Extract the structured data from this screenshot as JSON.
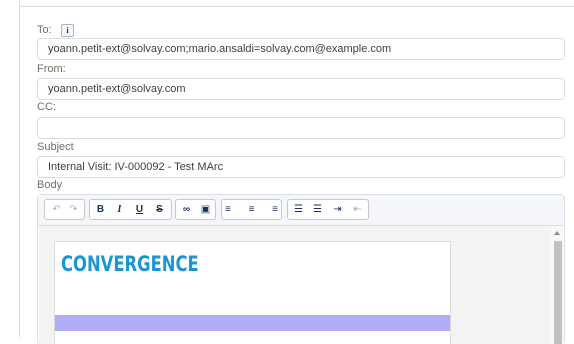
{
  "form": {
    "to_label": "To:",
    "info_icon_glyph": "i",
    "to_value": "yoann.petit-ext@solvay.com;mario.ansaldi=solvay.com@example.com",
    "from_label": "From:",
    "from_value": "yoann.petit-ext@solvay.com",
    "cc_label": "CC:",
    "cc_value": "",
    "subject_label": "Subject",
    "subject_value": "Internal Visit: IV-000092 - Test MArc",
    "body_label": "Body"
  },
  "toolbar": {
    "undo_icon": "↶",
    "redo_icon": "↷",
    "bold": "B",
    "italic": "I",
    "underline": "U",
    "strike": "S",
    "link_icon": "∞",
    "image_icon": "▣",
    "align_left_icon": "≡",
    "align_center_icon": "≡",
    "align_right_icon": "≡",
    "bullet_list_icon": "☰",
    "numbered_list_icon": "☰",
    "indent_icon": "⇥",
    "outdent_icon": "⇤"
  },
  "body": {
    "logo_text": "CONVERGENCE"
  },
  "colors": {
    "logo": "#1b96d3",
    "band": "#b1acf7",
    "border": "#d8dde6",
    "label": "#706e6b"
  }
}
